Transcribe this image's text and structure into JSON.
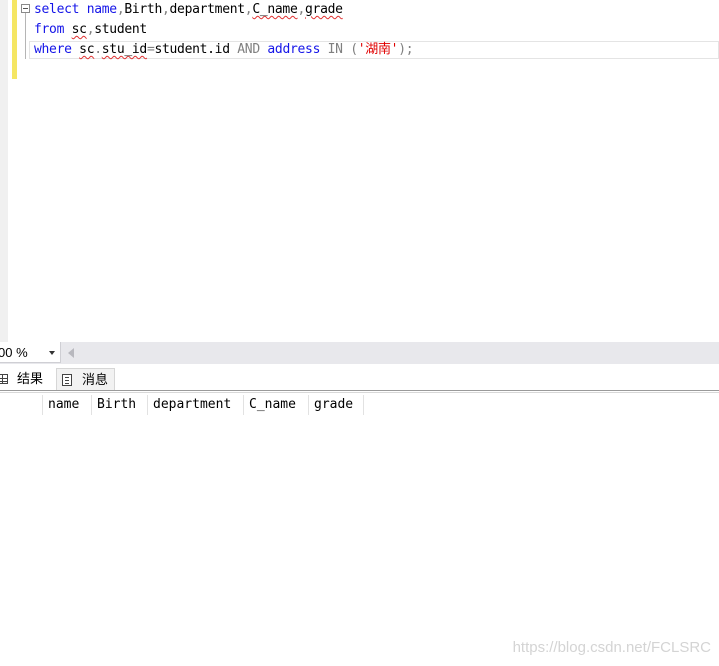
{
  "editor": {
    "line1": {
      "kw_select": "select",
      "col_name": "name",
      "comma1": ",",
      "col_birth": "Birth",
      "comma2": ",",
      "col_department": "department",
      "comma3": ",",
      "col_cname": "C_name",
      "comma4": ",",
      "col_grade": "grade"
    },
    "line2": {
      "kw_from": "from",
      "tbl_sc": "sc",
      "comma": ",",
      "tbl_student": "student"
    },
    "line3": {
      "kw_where": "where",
      "expr_sc": "sc",
      "dot": ".",
      "expr_stuid": "stu_id",
      "eq": "=",
      "expr_student_id": "student.id",
      "kw_and": "AND",
      "col_address": "address",
      "kw_in": "IN",
      "open_paren": "(",
      "str_value": "'湖南'",
      "close": ");"
    }
  },
  "zoom": {
    "value": "00 %"
  },
  "tabs": {
    "results": "结果",
    "messages": "消息"
  },
  "grid": {
    "columns": [
      "name",
      "Birth",
      "department",
      "C_name",
      "grade"
    ]
  },
  "watermark": "https://blog.csdn.net/FCLSRC",
  "colors": {
    "keyword": "#1515e8",
    "string": "#e00000",
    "operator": "#808080",
    "change_bar": "#f5e663"
  },
  "icons": [
    "fold-collapse-icon",
    "dropdown-arrow-icon",
    "scroll-left-icon",
    "results-grid-icon",
    "messages-icon"
  ]
}
